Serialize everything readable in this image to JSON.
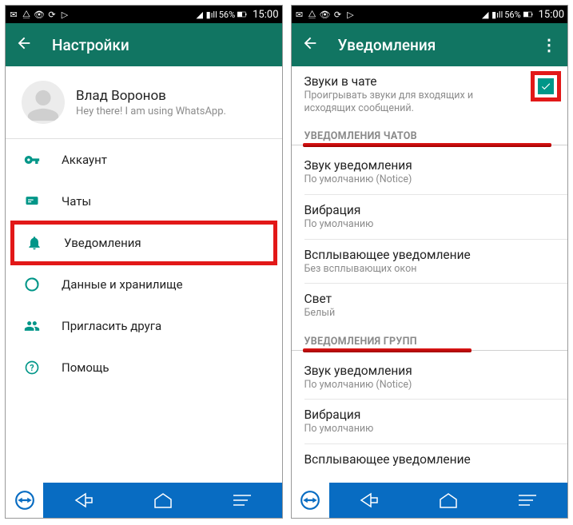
{
  "status": {
    "battery": "56%",
    "time": "15:00"
  },
  "left": {
    "title": "Настройки",
    "profile": {
      "name": "Влад Воронов",
      "status": "Hey there! I am using WhatsApp."
    },
    "items": [
      {
        "icon": "key",
        "label": "Аккаунт"
      },
      {
        "icon": "chat",
        "label": "Чаты"
      },
      {
        "icon": "bell",
        "label": "Уведомления",
        "highlight": true
      },
      {
        "icon": "data",
        "label": "Данные и хранилище"
      },
      {
        "icon": "invite",
        "label": "Пригласить друга"
      },
      {
        "icon": "help",
        "label": "Помощь"
      }
    ]
  },
  "right": {
    "title": "Уведомления",
    "chatSounds": {
      "title": "Звуки в чате",
      "sub": "Проигрывать звуки для входящих и исходящих сообщений.",
      "checked": true
    },
    "section1": "УВЕДОМЛЕНИЯ ЧАТОВ",
    "items1": [
      {
        "title": "Звук уведомления",
        "sub": "По умолчанию (Notice)"
      },
      {
        "title": "Вибрация",
        "sub": "По умолчанию"
      },
      {
        "title": "Всплывающее уведомление",
        "sub": "Без всплывающих окон"
      },
      {
        "title": "Свет",
        "sub": "Белый"
      }
    ],
    "section2": "УВЕДОМЛЕНИЯ ГРУПП",
    "items2": [
      {
        "title": "Звук уведомления",
        "sub": "По умолчанию (Notice)"
      },
      {
        "title": "Вибрация",
        "sub": "По умолчанию"
      },
      {
        "title": "Всплывающее уведомление",
        "sub": ""
      }
    ]
  }
}
